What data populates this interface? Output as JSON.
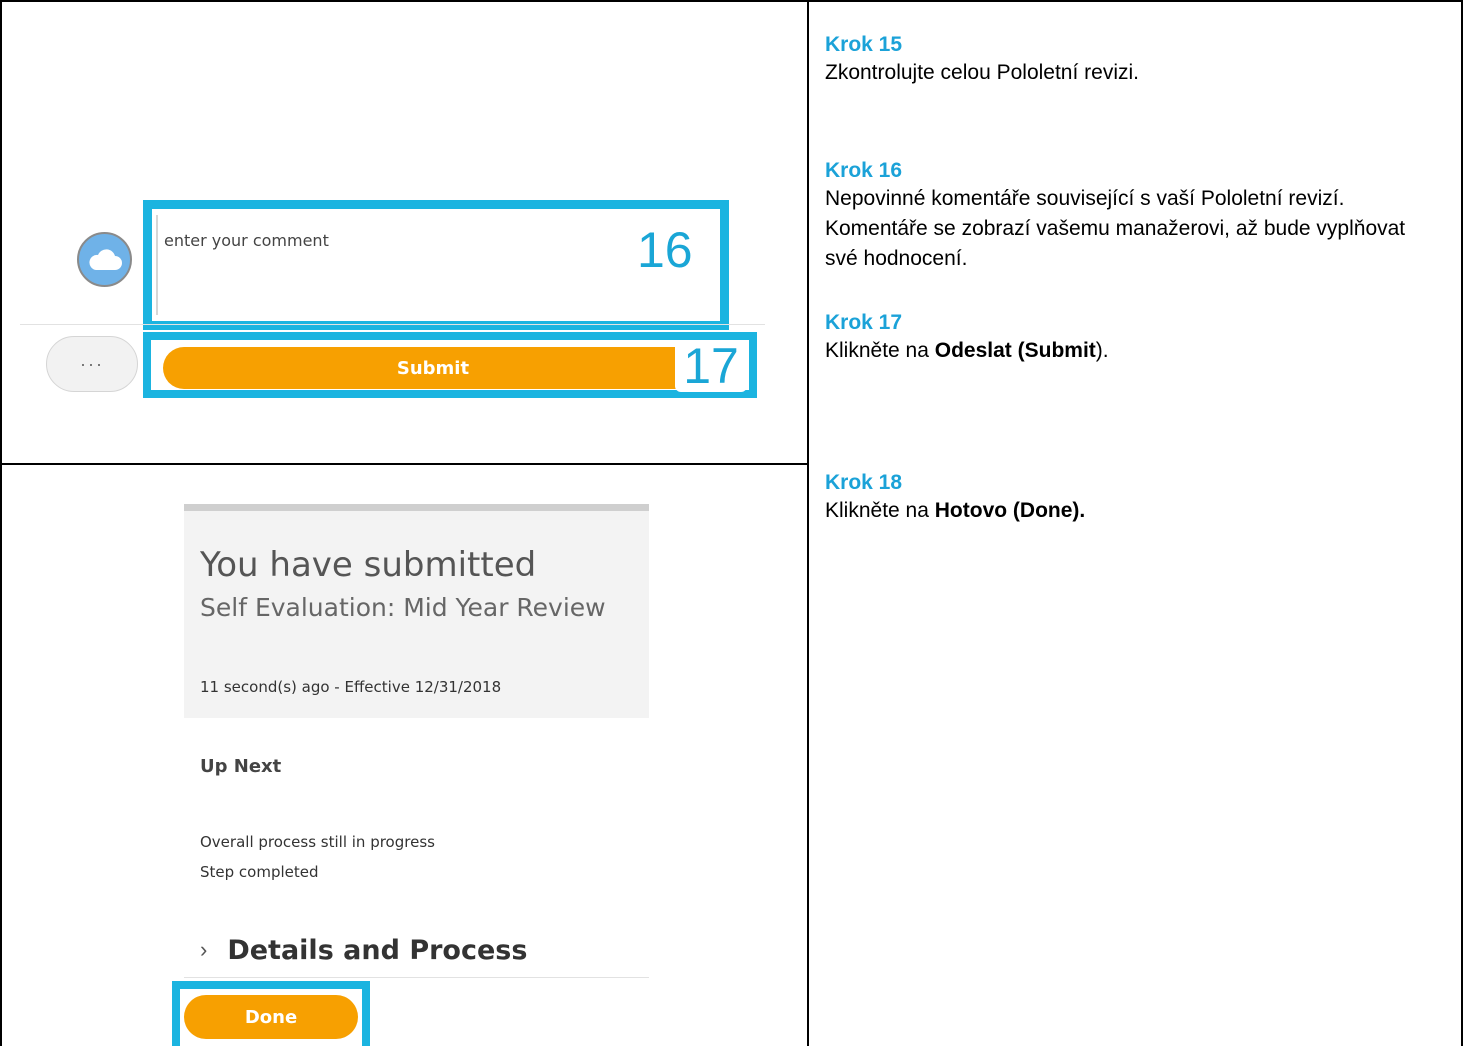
{
  "steps": [
    {
      "title": "Krok 15",
      "text": "Zkontrolujte celou Pololetní revizi."
    },
    {
      "title": "Krok 16",
      "text": "Nepovinné komentáře související s vaší Pololetní revizí. Komentáře se zobrazí vašemu manažerovi, až bude vyplňovat své hodnocení."
    },
    {
      "title": "Krok 17",
      "text_prefix": "Klikněte na ",
      "text_bold": "Odeslat (Submit",
      "text_suffix": ")."
    },
    {
      "title": "Krok 18",
      "text_prefix": "Klikněte na ",
      "text_bold": "Hotovo (Done)."
    }
  ],
  "comment": {
    "placeholder": "enter your comment",
    "callout": "16"
  },
  "actions": {
    "more_label": "···",
    "submit_label": "Submit",
    "submit_callout": "17"
  },
  "submitted": {
    "title": "You have submitted",
    "subtitle": "Self Evaluation: Mid Year Review",
    "meta": "11 second(s) ago - Effective 12/31/2018",
    "up_next": "Up Next",
    "status_1": "Overall process still in progress",
    "status_2": "Step completed",
    "details_label": "Details and Process",
    "done_label": "Done"
  },
  "colors": {
    "accent_blue": "#1bb4e0",
    "step_title": "#1ba2d8",
    "button_orange": "#f7a001"
  }
}
